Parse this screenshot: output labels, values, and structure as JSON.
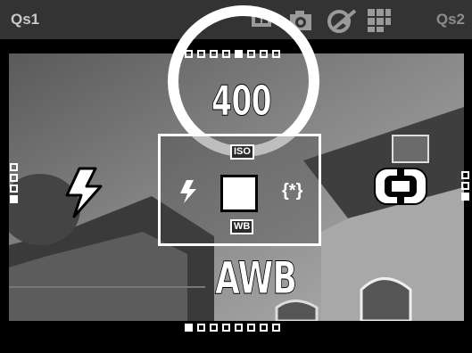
{
  "topbar": {
    "left_label": "Qs1",
    "right_label": "Qs2",
    "icons": [
      "drive-mode-icon",
      "camera-icon",
      "color-mode-icon",
      "grid-icon"
    ]
  },
  "iso": {
    "tag": "ISO",
    "value": "400",
    "dots": [
      false,
      false,
      false,
      false,
      true,
      false,
      false,
      false
    ],
    "highlighted": true
  },
  "white_balance": {
    "tag": "WB",
    "value": "AWB",
    "dots": [
      true,
      false,
      false,
      false,
      false,
      false,
      false,
      false
    ]
  },
  "left_setting": {
    "icon": "flash-icon",
    "dots": [
      false,
      false,
      false,
      true
    ]
  },
  "right_setting": {
    "icon": "spot-metering-icon",
    "dots": [
      false,
      false,
      true
    ]
  },
  "center_panel": {
    "left_icon": "flash-icon",
    "right_label": "{*}"
  },
  "colors": {
    "topbar_bg": "#333333",
    "panel_border": "#ffffff",
    "text": "#ffffff"
  }
}
